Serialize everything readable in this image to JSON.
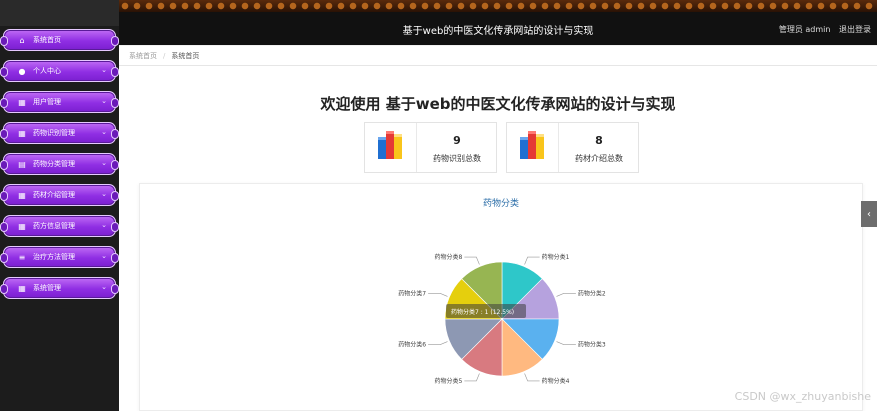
{
  "header": {
    "title": "基于web的中医文化传承网站的设计与实现",
    "admin_label": "管理员 admin",
    "logout_label": "退出登录"
  },
  "sidebar": {
    "items": [
      {
        "label": "系统首页",
        "icon": "home-icon",
        "has_arrow": false
      },
      {
        "label": "个人中心",
        "icon": "user-icon",
        "has_arrow": true
      },
      {
        "label": "用户管理",
        "icon": "grid-icon",
        "has_arrow": true
      },
      {
        "label": "药物识别管理",
        "icon": "grid-icon",
        "has_arrow": true
      },
      {
        "label": "药物分类管理",
        "icon": "list-icon",
        "has_arrow": true
      },
      {
        "label": "药材介绍管理",
        "icon": "grid-icon",
        "has_arrow": true
      },
      {
        "label": "药方信息管理",
        "icon": "grid-icon",
        "has_arrow": true
      },
      {
        "label": "治疗方法管理",
        "icon": "menu-icon",
        "has_arrow": true
      },
      {
        "label": "系统管理",
        "icon": "grid-icon",
        "has_arrow": true
      }
    ]
  },
  "breadcrumb": {
    "root": "系统首页",
    "current": "系统首页"
  },
  "main": {
    "welcome": "欢迎使用 基于web的中医文化传承网站的设计与实现",
    "stats": [
      {
        "value": "9",
        "label": "药物识别总数"
      },
      {
        "value": "8",
        "label": "药材介绍总数"
      }
    ]
  },
  "chart_data": {
    "type": "pie",
    "title": "药物分类",
    "categories": [
      "药物分类1",
      "药物分类2",
      "药物分类3",
      "药物分类4",
      "药物分类5",
      "药物分类6",
      "药物分类7",
      "药物分类8"
    ],
    "values": [
      1,
      1,
      1,
      1,
      1,
      1,
      1,
      1
    ],
    "colors": [
      "#2ec7c9",
      "#b6a2de",
      "#5ab1ef",
      "#ffb980",
      "#d87a80",
      "#8d98b3",
      "#e5cf0d",
      "#97b552"
    ],
    "tooltip": "药物分类7 : 1 (12.5%)",
    "legend": "none"
  },
  "watermark": "CSDN @wx_zhuyanbishe",
  "side_tab_icon": "chevron-left-icon"
}
